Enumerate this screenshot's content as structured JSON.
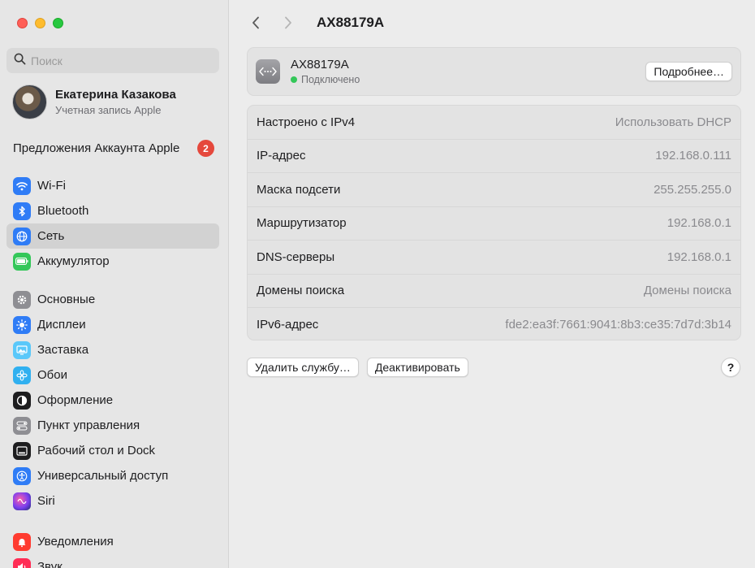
{
  "sidebar": {
    "search_placeholder": "Поиск",
    "account": {
      "name": "Екатерина Казакова",
      "subtitle": "Учетная запись Apple"
    },
    "suggestions": {
      "label": "Предложения Аккаунта Apple",
      "badge": "2"
    },
    "group1": [
      {
        "label": "Wi-Fi",
        "icon": "wifi-icon",
        "color": "#2f7cf6"
      },
      {
        "label": "Bluetooth",
        "icon": "bluetooth-icon",
        "color": "#2f7cf6"
      },
      {
        "label": "Сеть",
        "icon": "globe-icon",
        "color": "#2f7cf6",
        "active": true
      },
      {
        "label": "Аккумулятор",
        "icon": "battery-icon",
        "color": "#34c759"
      }
    ],
    "group2": [
      {
        "label": "Основные",
        "icon": "gear-icon",
        "color": "#8e8e93"
      },
      {
        "label": "Дисплеи",
        "icon": "sun-icon",
        "color": "#2f7cf6"
      },
      {
        "label": "Заставка",
        "icon": "screensaver-icon",
        "color": "#5ac8fa"
      },
      {
        "label": "Обои",
        "icon": "flower-icon",
        "color": "#30b0f0"
      },
      {
        "label": "Оформление",
        "icon": "appearance-icon",
        "color": "#1d1d1f"
      },
      {
        "label": "Пункт управления",
        "icon": "control-center-icon",
        "color": "#8e8e93"
      },
      {
        "label": "Рабочий стол и Dock",
        "icon": "dock-icon",
        "color": "#1d1d1f"
      },
      {
        "label": "Универсальный доступ",
        "icon": "accessibility-icon",
        "color": "#2f7cf6"
      },
      {
        "label": "Siri",
        "icon": "siri-icon",
        "color": "#5b3fd6"
      }
    ],
    "group3": [
      {
        "label": "Уведомления",
        "icon": "bell-icon",
        "color": "#ff3b30"
      },
      {
        "label": "Звук",
        "icon": "speaker-icon",
        "color": "#ff2d55"
      }
    ]
  },
  "main": {
    "title": "AX88179A",
    "service": {
      "name": "AX88179A",
      "status": "Подключено",
      "details_button": "Подробнее…"
    },
    "rows": [
      {
        "label": "Настроено с IPv4",
        "value": "Использовать DHCP"
      },
      {
        "label": "IP-адрес",
        "value": "192.168.0.111"
      },
      {
        "label": "Маска подсети",
        "value": "255.255.255.0"
      },
      {
        "label": "Маршрутизатор",
        "value": "192.168.0.1"
      },
      {
        "label": "DNS-серверы",
        "value": "192.168.0.1"
      },
      {
        "label": "Домены поиска",
        "value": "Домены поиска"
      },
      {
        "label": "IPv6-адрес",
        "value": "fde2:ea3f:7661:9041:8b3:ce35:7d7d:3b14"
      }
    ],
    "actions": {
      "delete": "Удалить службу…",
      "deactivate": "Деактивировать",
      "help": "?"
    }
  }
}
